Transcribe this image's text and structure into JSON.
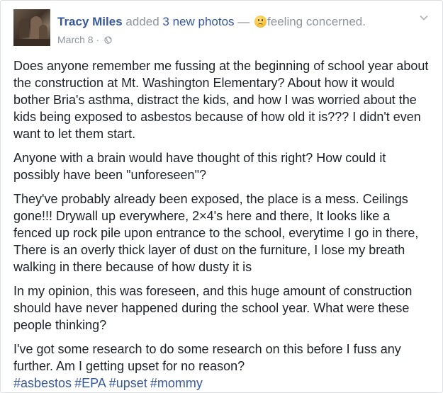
{
  "post": {
    "author": "Tracy Miles",
    "action_text": "added",
    "photos_text": "3 new photos",
    "dash": "—",
    "feeling_text": "feeling concerned.",
    "feeling_icon": "concerned-face-icon",
    "date": "March 8",
    "separator": "·",
    "privacy_icon": "globe-icon",
    "menu_icon": "chevron-down-icon",
    "paragraphs": [
      "Does anyone remember me fussing at the beginning of school year about the construction at Mt. Washington Elementary? About how it would bother Bria's asthma, distract the kids, and how I was worried about the kids being exposed to asbestos because of how old it is??? I didn't even want to let them start.",
      "Anyone with a brain would have thought of this right? How could it possibly have been \"unforeseen\"?",
      "They've probably already been exposed, the place is a mess. Ceilings gone!!! Drywall up everywhere, 2×4's here and there, It looks like a fenced up rock pile upon entrance to the school, everytime I go in there, There is an overly thick layer of dust on the furniture, I lose my breath walking in there because of how dusty it is",
      "In my opinion, this was foreseen, and this huge amount of construction should have never happened during the school year. What were these people thinking?",
      "I've got some research to do some research on this before I fuss any further. Am I getting upset for no reason?"
    ],
    "hashtags": [
      "#asbestos",
      "#EPA",
      "#upset",
      "#mommy"
    ]
  },
  "colors": {
    "link": "#365899",
    "muted": "#90949c",
    "text": "#1d2129"
  }
}
